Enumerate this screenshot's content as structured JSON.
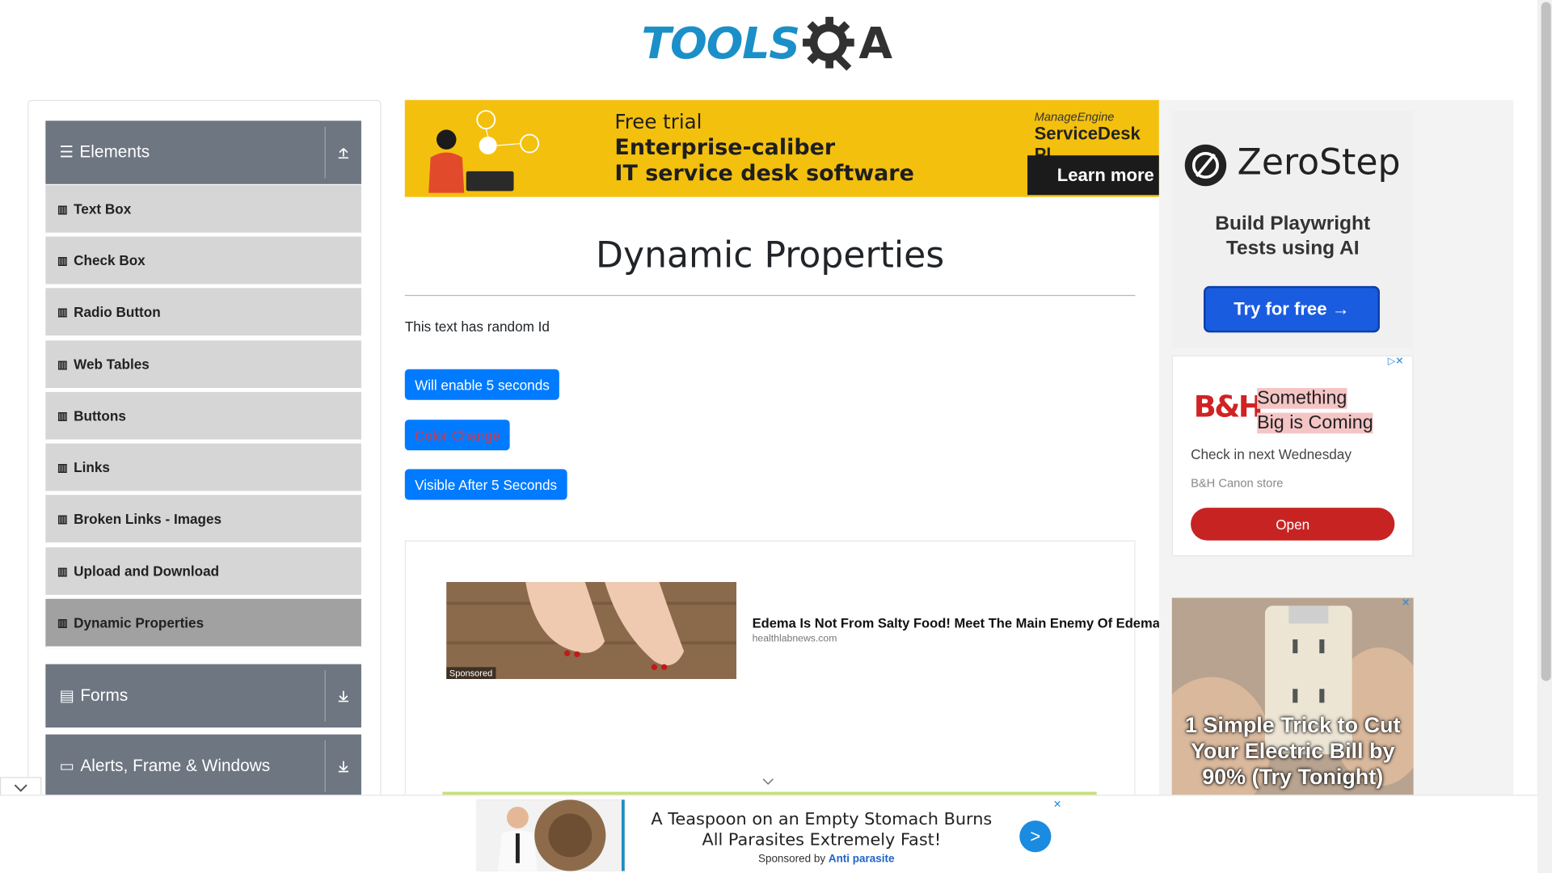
{
  "header": {
    "logo_text_part1": "TOOLS",
    "logo_text_part2": "A"
  },
  "sidebar": {
    "groups": [
      {
        "label": "Elements",
        "icon": "hamburger-icon",
        "state": "expanded"
      },
      {
        "label": "Forms",
        "icon": "document-icon",
        "state": "collapsed"
      },
      {
        "label": "Alerts, Frame & Windows",
        "icon": "window-icon",
        "state": "collapsed"
      }
    ],
    "items": [
      {
        "label": "Text Box"
      },
      {
        "label": "Check Box"
      },
      {
        "label": "Radio Button"
      },
      {
        "label": "Web Tables"
      },
      {
        "label": "Buttons"
      },
      {
        "label": "Links"
      },
      {
        "label": "Broken Links - Images"
      },
      {
        "label": "Upload and Download"
      },
      {
        "label": "Dynamic Properties",
        "active": true
      }
    ]
  },
  "top_ad": {
    "line1": "Free trial",
    "line2": "Enterprise-caliber",
    "line3": "IT service desk software",
    "brand_small": "ManageEngine",
    "brand": "ServiceDesk Pl",
    "cta": "Learn more",
    "bg_color": "#f4c00e"
  },
  "main": {
    "title": "Dynamic Properties",
    "random_text": "This text has random Id",
    "buttons": {
      "enable": "Will enable 5 seconds",
      "color_change": "Color Change",
      "visible_after": "Visible After 5 Seconds"
    },
    "accent_color": "#007bff"
  },
  "content_ad": {
    "sponsored": "Sponsored",
    "title": "Edema Is Not From Salty Food! Meet The Main Enemy Of Edema",
    "source": "healthlabnews.com"
  },
  "right_ads": {
    "zerostep": {
      "name": "ZeroStep",
      "tagline_1": "Build Playwright",
      "tagline_2": "Tests using AI",
      "cta": "Try for free →"
    },
    "bh": {
      "logo": "B&H",
      "headline_1": "Something",
      "headline_2": "Big is Coming",
      "sub": "Check in next Wednesday",
      "store": "B&H Canon store",
      "cta": "Open"
    },
    "outlet": {
      "text": "1 Simple Trick to Cut Your Electric Bill by 90% (Try Tonight)"
    }
  },
  "bottom_ad": {
    "text": "A Teaspoon on an Empty Stomach Burns All Parasites Extremely Fast!",
    "sponsored_prefix": "Sponsored by",
    "sponsor": "Anti parasite",
    "go": ">"
  }
}
